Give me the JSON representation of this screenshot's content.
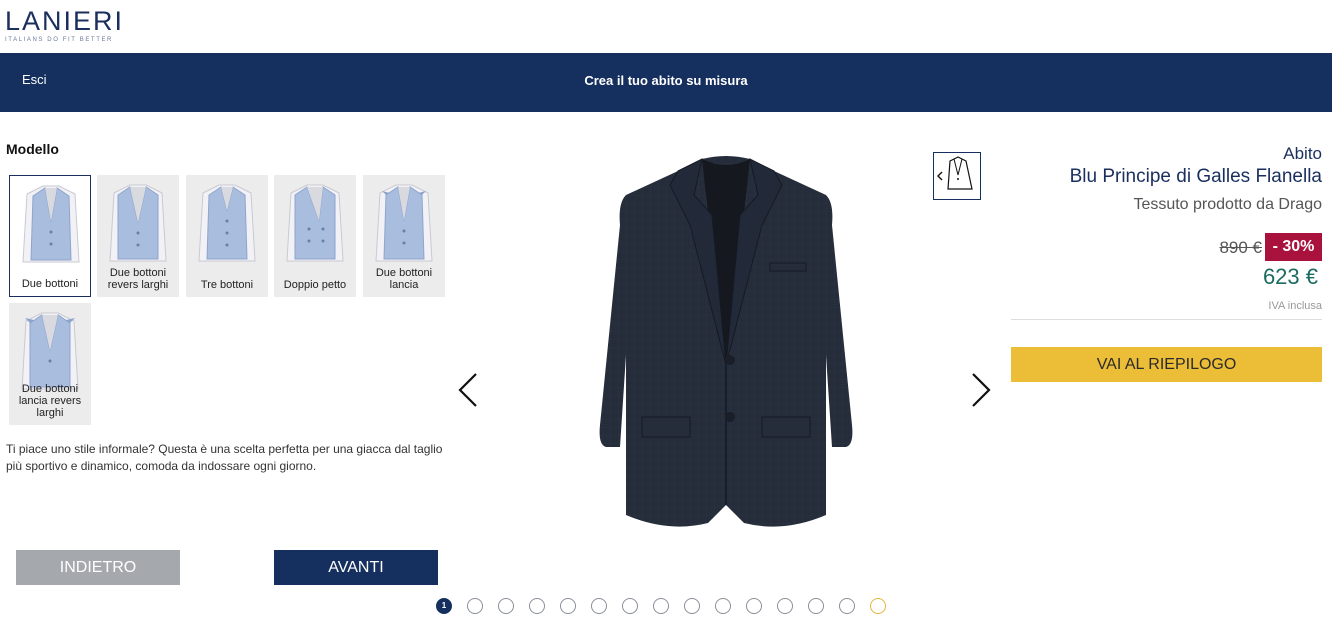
{
  "brand": {
    "name": "LANIERI",
    "tagline": "ITALIANS DO FIT BETTER"
  },
  "header": {
    "exit_label": "Esci",
    "title": "Crea il tuo abito su misura"
  },
  "section": {
    "title": "Modello"
  },
  "models": [
    {
      "label": "Due bottoni",
      "selected": true
    },
    {
      "label": "Due bottoni revers larghi",
      "selected": false
    },
    {
      "label": "Tre bottoni",
      "selected": false
    },
    {
      "label": "Doppio petto",
      "selected": false
    },
    {
      "label": "Due bottoni lancia",
      "selected": false
    },
    {
      "label": "Due bottoni lancia revers larghi",
      "selected": false
    }
  ],
  "description": "Ti piace uno stile informale? Questa è una scelta perfetta per una giacca dal taglio più sportivo e dinamico, comoda da indossare ogni giorno.",
  "nav": {
    "back_label": "INDIETRO",
    "next_label": "AVANTI"
  },
  "product": {
    "type": "Abito",
    "name": "Blu Principe di Galles Flanella",
    "fabric": "Tessuto prodotto da Drago",
    "old_price": "890 €",
    "discount": "- 30%",
    "new_price": "623 €",
    "vat_note": "IVA inclusa"
  },
  "summary_button": "VAI AL RIEPILOGO",
  "pager": {
    "current": "1",
    "total_steps": 15
  },
  "colors": {
    "navy": "#15305f",
    "accent": "#ecbd36",
    "discount": "#a8123c",
    "price": "#1b6b5f"
  }
}
